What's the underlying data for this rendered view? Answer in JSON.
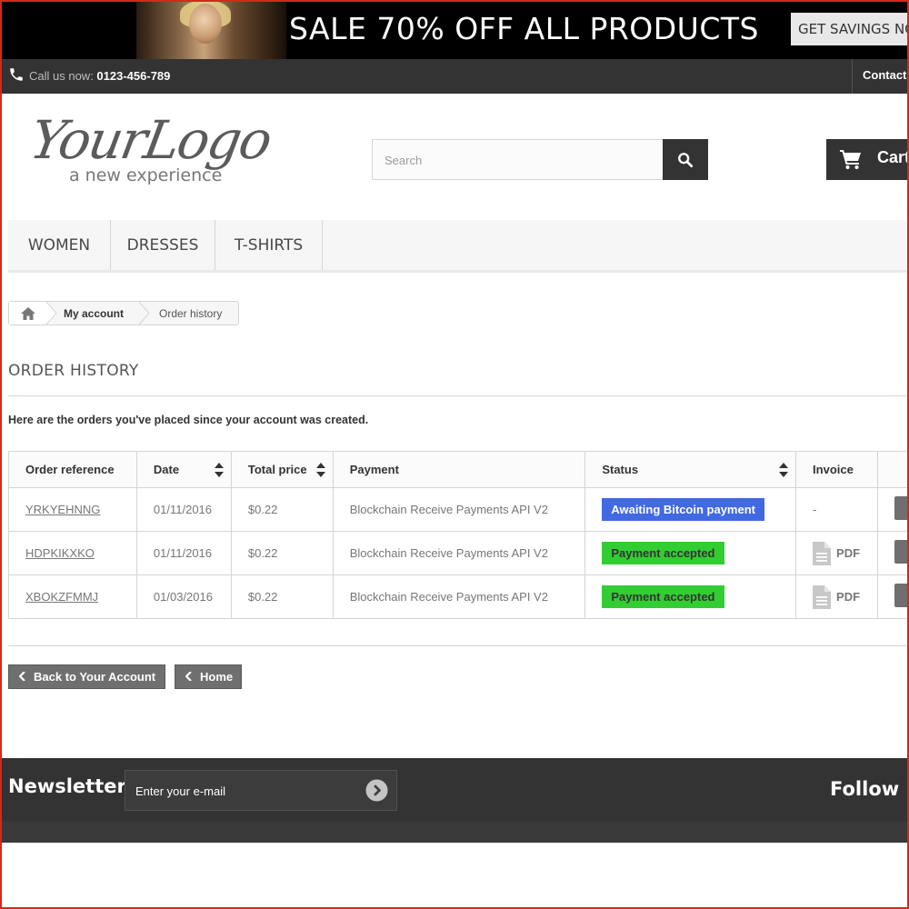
{
  "banner": {
    "sale_text": "SALE 70% OFF ALL PRODUCTS",
    "cta_label": "GET SAVINGS NOW"
  },
  "topbar": {
    "call_label": "Call us now: ",
    "phone": "0123-456-789",
    "contact_label": "Contact us"
  },
  "header": {
    "logo_script": "YourLogo",
    "logo_tagline": "a new experience",
    "search_placeholder": "Search",
    "cart_label": "Cart"
  },
  "menu": {
    "items": [
      {
        "label": "WOMEN"
      },
      {
        "label": "DRESSES"
      },
      {
        "label": "T-SHIRTS"
      }
    ]
  },
  "breadcrumb": {
    "items": [
      {
        "label": "My account"
      },
      {
        "label": "Order history"
      }
    ]
  },
  "page": {
    "title": "ORDER HISTORY",
    "intro": "Here are the orders you've placed since your account was created."
  },
  "table": {
    "headers": [
      "Order reference",
      "Date",
      "Total price",
      "Payment",
      "Status",
      "Invoice"
    ],
    "rows": [
      {
        "ref": "YRKYEHNNG",
        "date": "01/11/2016",
        "total": "$0.22",
        "payment": "Blockchain Receive Payments API V2",
        "status": "Awaiting Bitcoin payment",
        "status_color": "#4169e1",
        "invoice": "-"
      },
      {
        "ref": "HDPKIKXKO",
        "date": "01/11/2016",
        "total": "$0.22",
        "payment": "Blockchain Receive Payments API V2",
        "status": "Payment accepted",
        "status_color": "#32cd32",
        "invoice": "PDF"
      },
      {
        "ref": "XBOKZFMMJ",
        "date": "01/03/2016",
        "total": "$0.22",
        "payment": "Blockchain Receive Payments API V2",
        "status": "Payment accepted",
        "status_color": "#32cd32",
        "invoice": "PDF"
      }
    ]
  },
  "actions": {
    "back_label": "Back to Your Account",
    "home_label": "Home"
  },
  "footer": {
    "newsletter_title": "Newsletter",
    "email_placeholder": "Enter your e-mail",
    "follow_title": "Follow us"
  },
  "icons": {
    "phone": "phone-icon",
    "search": "search-icon",
    "cart": "cart-icon",
    "home": "home-icon",
    "sort": "sort-icon",
    "pdf": "file-text-icon",
    "chevron": "chevron-left-icon",
    "go": "chevron-circle-right-icon"
  },
  "colors": {
    "dark": "#333333",
    "accent_border": "#d9261c",
    "status_blue": "#4169e1",
    "status_green": "#32cd32"
  }
}
